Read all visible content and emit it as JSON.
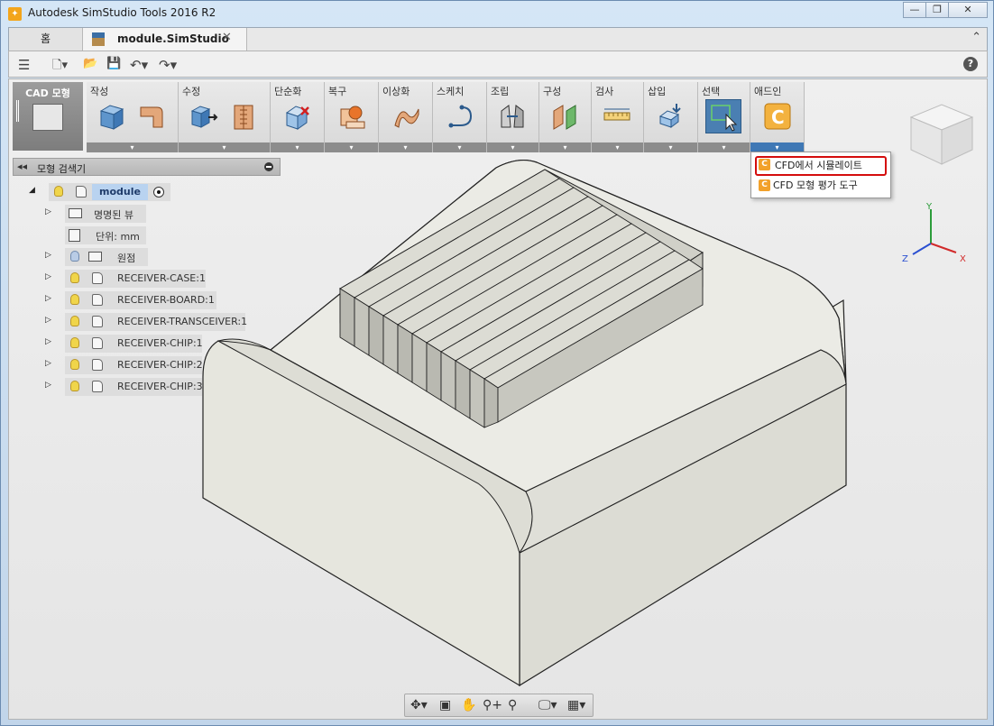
{
  "window": {
    "title": "Autodesk SimStudio Tools 2016 R2",
    "app_icon_glyph": "✦",
    "controls": [
      "—",
      "❐",
      "✕"
    ]
  },
  "tabs": {
    "home": "홈",
    "document": "module.SimStudio",
    "close_glyph": "✕",
    "collapse_glyph": "⌃"
  },
  "quick_toolbar": {
    "menu_glyph": "☰",
    "new_glyph": "🗋▾",
    "open_glyph": "📂",
    "save_glyph": "💾",
    "undo_glyph": "↶▾",
    "redo_glyph": "↷▾",
    "help_glyph": "?"
  },
  "workspace": {
    "label": "CAD 모형"
  },
  "ribbon": {
    "groups": [
      "작성",
      "수정",
      "단순화",
      "복구",
      "이상화",
      "스케치",
      "조립",
      "구성",
      "검사",
      "삽입",
      "선택",
      "애드인"
    ],
    "dropdown_glyph": "▾"
  },
  "addin_menu": {
    "items": [
      "CFD에서 시뮬레이트",
      "CFD 모형 평가 도구"
    ],
    "icon_glyph": "C"
  },
  "browser": {
    "collapse_glyph": "◂◂",
    "title": "모형 검색기",
    "root": "module",
    "named_views": "명명된 뷰",
    "units": "단위: mm",
    "origin": "원점",
    "components": [
      "RECEIVER-CASE:1",
      "RECEIVER-BOARD:1",
      "RECEIVER-TRANSCEIVER:1",
      "RECEIVER-CHIP:1",
      "RECEIVER-CHIP:2",
      "RECEIVER-CHIP:3"
    ],
    "expanded_glyph": "◢",
    "collapsed_glyph": "▷"
  },
  "axes": {
    "x": "X",
    "y": "Y",
    "z": "Z"
  },
  "navbar": {
    "icons": [
      "✥▾",
      "▣",
      "✋",
      "⚲+",
      "⚲",
      "🖵▾",
      "▦▾"
    ]
  }
}
